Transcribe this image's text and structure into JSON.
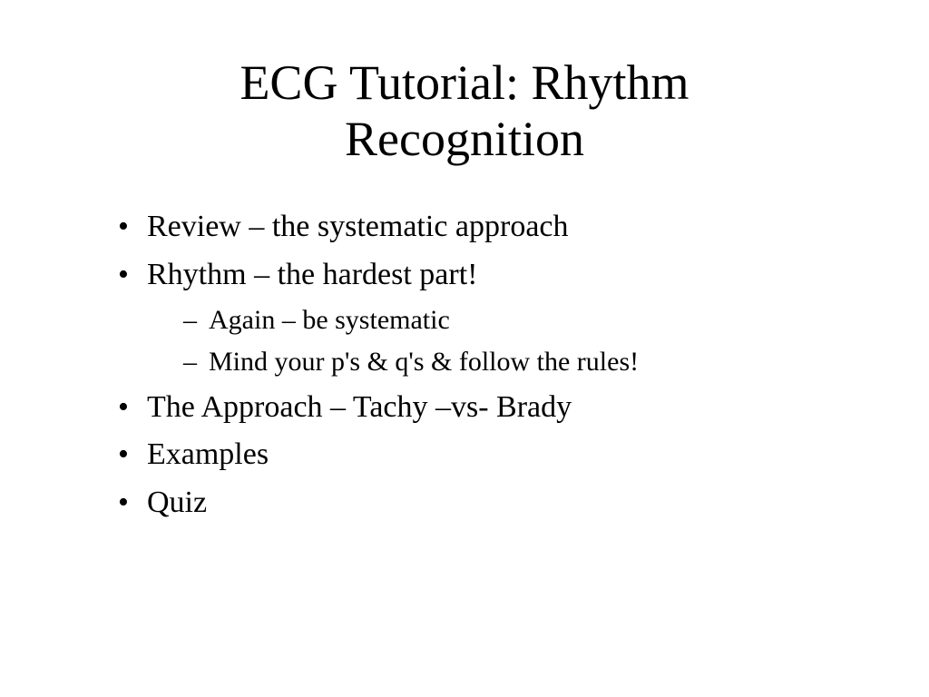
{
  "slide": {
    "title": "ECG Tutorial:  Rhythm Recognition",
    "bullets": [
      {
        "text": "Review – the systematic approach"
      },
      {
        "text": "Rhythm – the hardest part!",
        "sub": [
          "Again – be systematic",
          "Mind your p's & q's & follow the rules!"
        ]
      },
      {
        "text": "The Approach – Tachy –vs- Brady"
      },
      {
        "text": "Examples"
      },
      {
        "text": "Quiz"
      }
    ]
  }
}
